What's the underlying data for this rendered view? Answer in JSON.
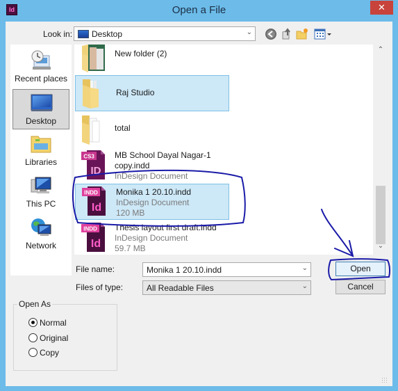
{
  "window": {
    "app_icon": "Id",
    "title": "Open a File",
    "close_icon": "✕"
  },
  "toolbar": {
    "look_in_label": "Look in:",
    "look_in_value": "Desktop",
    "icons": [
      "back-icon",
      "up-folder-icon",
      "new-folder-icon",
      "view-menu-icon"
    ]
  },
  "places": [
    {
      "label": "Recent places",
      "icon": "recent-places-icon",
      "selected": false
    },
    {
      "label": "Desktop",
      "icon": "desktop-icon",
      "selected": true
    },
    {
      "label": "Libraries",
      "icon": "libraries-icon",
      "selected": false
    },
    {
      "label": "This PC",
      "icon": "this-pc-icon",
      "selected": false
    },
    {
      "label": "Network",
      "icon": "network-icon",
      "selected": false
    }
  ],
  "files": [
    {
      "name": "New folder (2)",
      "type": "",
      "size": "",
      "icon": "folder-photo-icon",
      "selected": false
    },
    {
      "name": "Raj Studio",
      "type": "",
      "size": "",
      "icon": "folder-icon",
      "selected": true
    },
    {
      "name": "total",
      "type": "",
      "size": "",
      "icon": "folder-icon",
      "selected": false
    },
    {
      "name": "MB School Dayal Nagar-1 copy.indd",
      "name_line1": "MB School Dayal Nagar-1",
      "name_line2": "copy.indd",
      "type": "InDesign Document",
      "size": "",
      "icon": "indesign-cs3-icon",
      "badge": "CS3",
      "glyph": "ID",
      "selected": false
    },
    {
      "name": "Monika 1 20.10.indd",
      "type": "InDesign Document",
      "size": "120 MB",
      "icon": "indesign-indd-icon",
      "badge": "INDD",
      "glyph": "Id",
      "selected": true
    },
    {
      "name": "Thesis layout first draft.indd",
      "type": "InDesign Document",
      "size": "59.7 MB",
      "icon": "indesign-indd-icon",
      "badge": "INDD",
      "glyph": "Id",
      "selected": false
    }
  ],
  "form": {
    "file_name_label": "File name:",
    "file_name_value": "Monika 1 20.10.indd",
    "files_of_type_label": "Files of type:",
    "files_of_type_value": "All Readable Files",
    "open_label": "Open",
    "cancel_label": "Cancel"
  },
  "open_as": {
    "label": "Open As",
    "options": [
      {
        "label": "Normal",
        "checked": true
      },
      {
        "label": "Original",
        "checked": false
      },
      {
        "label": "Copy",
        "checked": false
      }
    ]
  },
  "scrollbar": {
    "up": "⌃",
    "down": "⌄",
    "position_fraction": 0.78
  },
  "colors": {
    "annotation": "#1a1aa8",
    "selection": "#cde8f7",
    "titlebar": "#6cbbe9",
    "close": "#c8433b"
  }
}
